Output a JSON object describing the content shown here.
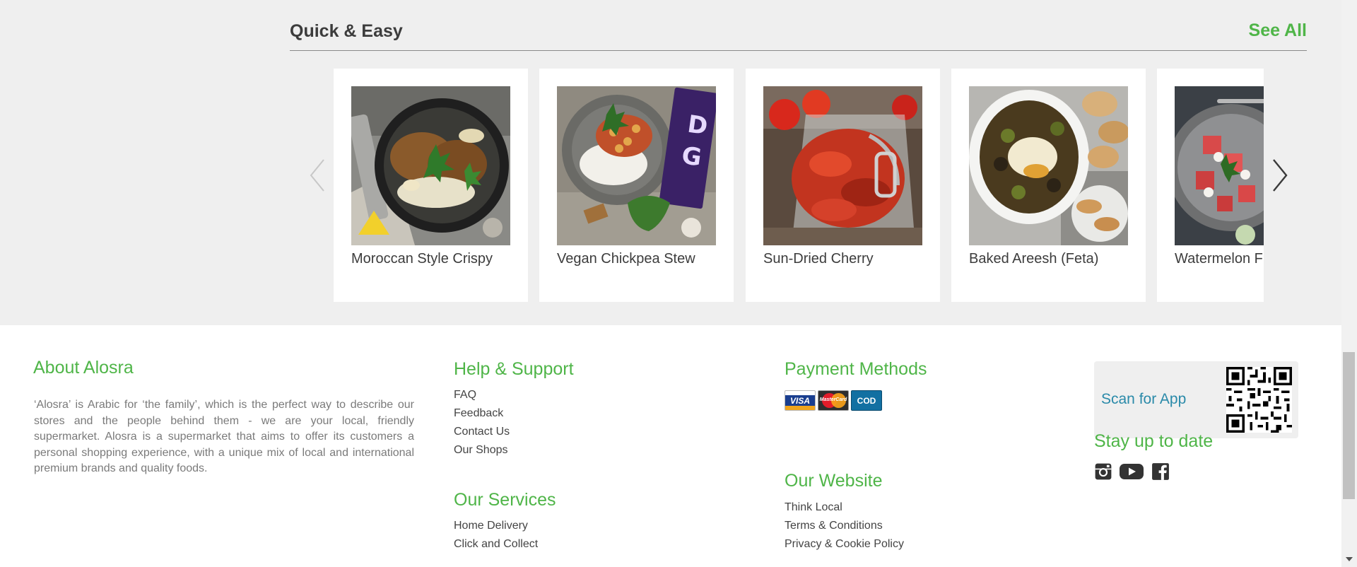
{
  "section": {
    "title": "Quick & Easy",
    "see_all": "See All",
    "recipes": [
      {
        "name": "Moroccan Style Crispy"
      },
      {
        "name": "Vegan Chickpea Stew"
      },
      {
        "name": "Sun-Dried Cherry"
      },
      {
        "name": "Baked Areesh (Feta)"
      },
      {
        "name": "Watermelon F"
      }
    ]
  },
  "footer": {
    "about": {
      "title": "About Alosra",
      "text": "‘Alosra’ is Arabic for ‘the family’, which is the perfect way to describe our stores and the people behind them - we are your local, friendly supermarket. Alosra is a supermarket that aims to offer its customers a personal shopping experience, with a unique mix of local and international premium brands and quality foods."
    },
    "help": {
      "title": "Help & Support",
      "links": [
        "FAQ",
        "Feedback",
        "Contact Us",
        "Our Shops"
      ]
    },
    "services": {
      "title": "Our Services",
      "links": [
        "Home Delivery",
        "Click and Collect"
      ]
    },
    "payment": {
      "title": "Payment Methods",
      "methods": [
        "VISA",
        "MasterCard",
        "COD"
      ]
    },
    "website": {
      "title": "Our Website",
      "links": [
        "Think Local",
        "Terms & Conditions",
        "Privacy & Cookie Policy"
      ]
    },
    "app": {
      "label": "Scan for App",
      "qr_icon": "qr-code-icon"
    },
    "social": {
      "title": "Stay up to date",
      "icons": [
        "instagram-icon",
        "youtube-icon",
        "facebook-icon"
      ]
    }
  },
  "colors": {
    "accent_green": "#4fb548",
    "app_link_blue": "#2a8aa9",
    "section_bg": "#efefef"
  }
}
